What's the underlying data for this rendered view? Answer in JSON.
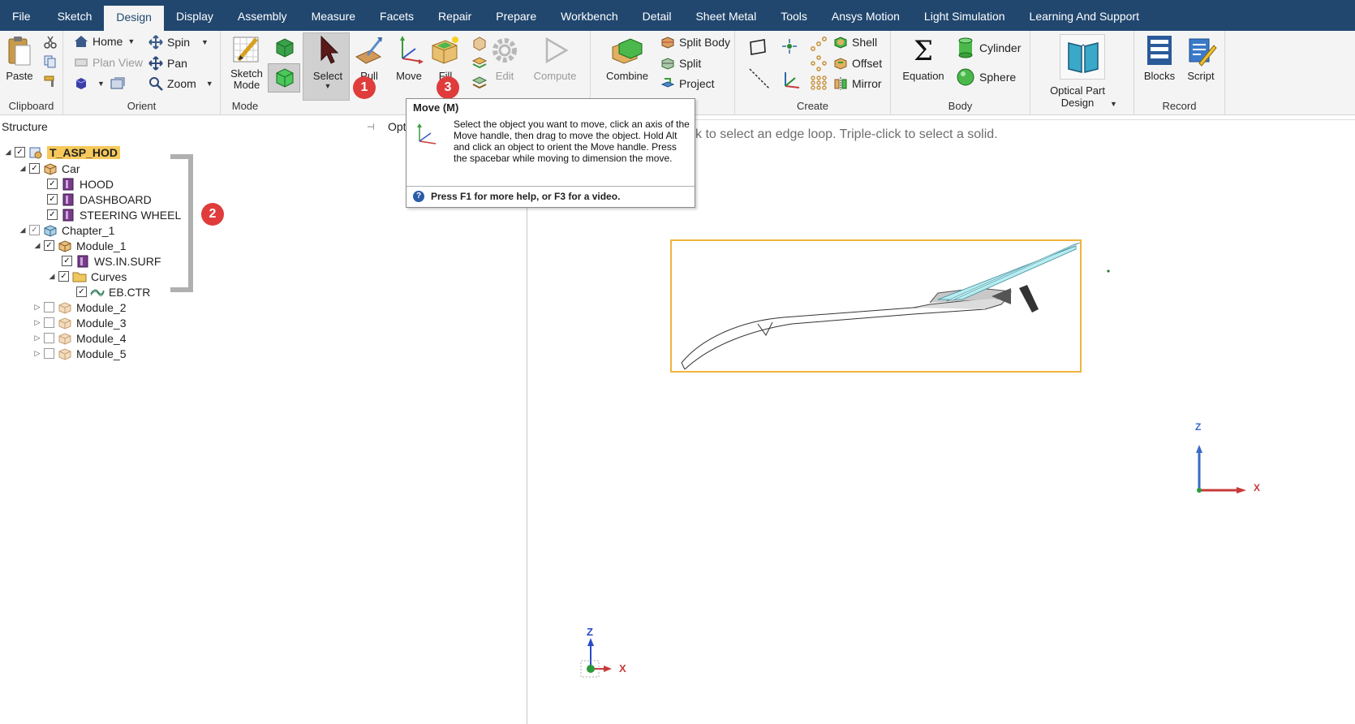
{
  "tabs": [
    {
      "label": "File"
    },
    {
      "label": "Sketch"
    },
    {
      "label": "Design",
      "active": true
    },
    {
      "label": "Display"
    },
    {
      "label": "Assembly"
    },
    {
      "label": "Measure"
    },
    {
      "label": "Facets"
    },
    {
      "label": "Repair"
    },
    {
      "label": "Prepare"
    },
    {
      "label": "Workbench"
    },
    {
      "label": "Detail"
    },
    {
      "label": "Sheet Metal"
    },
    {
      "label": "Tools"
    },
    {
      "label": "Ansys Motion"
    },
    {
      "label": "Light Simulation"
    },
    {
      "label": "Learning And Support"
    }
  ],
  "ribbon": {
    "clipboard": {
      "label": "Clipboard",
      "paste": "Paste"
    },
    "orient": {
      "label": "Orient",
      "home": "Home",
      "plan_view": "Plan View",
      "spin": "Spin",
      "pan": "Pan",
      "zoom": "Zoom"
    },
    "mode": {
      "label": "Mode",
      "sketch_mode": "Sketch Mode"
    },
    "edit": {
      "select": "Select",
      "pull": "Pull",
      "move": "Move",
      "fill": "Fill",
      "edit": "Edit",
      "compute": "Compute"
    },
    "intersect": {
      "combine": "Combine",
      "split_body": "Split Body",
      "split": "Split",
      "project": "Project"
    },
    "create": {
      "label": "Create",
      "shell": "Shell",
      "offset": "Offset",
      "mirror": "Mirror"
    },
    "body": {
      "label": "Body",
      "equation": "Equation",
      "cylinder": "Cylinder",
      "sphere": "Sphere"
    },
    "optical": {
      "label": "Optical Part Design"
    },
    "record": {
      "label": "Record",
      "blocks": "Blocks",
      "script": "Script"
    }
  },
  "badges": {
    "one": "1",
    "two": "2",
    "three": "3"
  },
  "structure": {
    "title": "Structure",
    "options_tab": "Option",
    "tree": {
      "root": "T_ASP_HOD",
      "car": "Car",
      "hood": "HOOD",
      "dashboard": "DASHBOARD",
      "steering_wheel": "STEERING WHEEL",
      "chapter_1": "Chapter_1",
      "module_1": "Module_1",
      "ws_in_surf": "WS.IN.SURF",
      "curves": "Curves",
      "eb_ctr": "EB.CTR",
      "module_2": "Module_2",
      "module_3": "Module_3",
      "module_4": "Module_4",
      "module_5": "Module_5"
    }
  },
  "viewport": {
    "hint": "k to select an edge loop. Triple-click to select a solid.",
    "triad_main": {
      "z": "Z",
      "x": "X"
    },
    "triad_corner": {
      "z": "Z",
      "x": "X"
    }
  },
  "tooltip": {
    "title": "Move  (M)",
    "body": "Select the object you want to move, click an axis of the Move handle, then drag to move the object. Hold Alt and click an object to orient the Move handle. Press the spacebar while moving to dimension the move.",
    "help": "Press F1 for more help, or F3 for a video."
  },
  "colors": {
    "tabbar": "#21476f",
    "ribbon": "#f4f4f4",
    "badge": "#e03c3c",
    "highlight": "#f7c95b",
    "selection_box": "#f0b43c"
  }
}
